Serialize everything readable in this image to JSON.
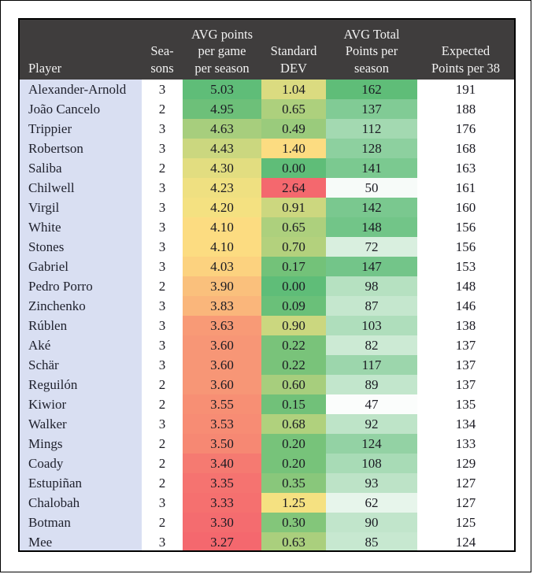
{
  "table": {
    "columns": [
      {
        "key": "player",
        "label": "Player",
        "align": "left"
      },
      {
        "key": "seasons",
        "label": "Sea-\nsons",
        "align": "center"
      },
      {
        "key": "avgpg",
        "label": "AVG points\nper game\nper season",
        "align": "center"
      },
      {
        "key": "sd",
        "label": "Standard\nDEV",
        "align": "center"
      },
      {
        "key": "avgtot",
        "label": "AVG Total\nPoints per\nseason",
        "align": "center"
      },
      {
        "key": "exp",
        "label": "Expected\nPoints per 38",
        "align": "center"
      }
    ],
    "header_lines": {
      "player": [
        "Player"
      ],
      "seasons": [
        "Sea-",
        "sons"
      ],
      "avgpg": [
        "AVG points",
        "per game",
        "per season"
      ],
      "sd": [
        "Standard",
        "DEV"
      ],
      "avgtot": [
        "AVG Total",
        "Points per",
        "season"
      ],
      "exp": [
        "Expected",
        "Points per 38"
      ]
    },
    "rows": [
      {
        "player": "Alexander-Arnold",
        "seasons": "3",
        "avgpg": "5.03",
        "sd": "1.04",
        "avgtot": "162",
        "exp": "191"
      },
      {
        "player": "João Cancelo",
        "seasons": "2",
        "avgpg": "4.95",
        "sd": "0.65",
        "avgtot": "137",
        "exp": "188"
      },
      {
        "player": "Trippier",
        "seasons": "3",
        "avgpg": "4.63",
        "sd": "0.49",
        "avgtot": "112",
        "exp": "176"
      },
      {
        "player": "Robertson",
        "seasons": "3",
        "avgpg": "4.43",
        "sd": "1.40",
        "avgtot": "128",
        "exp": "168"
      },
      {
        "player": "Saliba",
        "seasons": "2",
        "avgpg": "4.30",
        "sd": "0.00",
        "avgtot": "141",
        "exp": "163"
      },
      {
        "player": "Chilwell",
        "seasons": "3",
        "avgpg": "4.23",
        "sd": "2.64",
        "avgtot": "50",
        "exp": "161"
      },
      {
        "player": "Virgil",
        "seasons": "3",
        "avgpg": "4.20",
        "sd": "0.91",
        "avgtot": "142",
        "exp": "160"
      },
      {
        "player": "White",
        "seasons": "3",
        "avgpg": "4.10",
        "sd": "0.65",
        "avgtot": "148",
        "exp": "156"
      },
      {
        "player": "Stones",
        "seasons": "3",
        "avgpg": "4.10",
        "sd": "0.70",
        "avgtot": "72",
        "exp": "156"
      },
      {
        "player": "Gabriel",
        "seasons": "3",
        "avgpg": "4.03",
        "sd": "0.17",
        "avgtot": "147",
        "exp": "153"
      },
      {
        "player": "Pedro Porro",
        "seasons": "2",
        "avgpg": "3.90",
        "sd": "0.00",
        "avgtot": "98",
        "exp": "148"
      },
      {
        "player": "Zinchenko",
        "seasons": "3",
        "avgpg": "3.83",
        "sd": "0.09",
        "avgtot": "87",
        "exp": "146"
      },
      {
        "player": "Rúblen",
        "seasons": "3",
        "avgpg": "3.63",
        "sd": "0.90",
        "avgtot": "103",
        "exp": "138"
      },
      {
        "player": "Aké",
        "seasons": "3",
        "avgpg": "3.60",
        "sd": "0.22",
        "avgtot": "82",
        "exp": "137"
      },
      {
        "player": "Schär",
        "seasons": "3",
        "avgpg": "3.60",
        "sd": "0.22",
        "avgtot": "117",
        "exp": "137"
      },
      {
        "player": "Reguilón",
        "seasons": "2",
        "avgpg": "3.60",
        "sd": "0.60",
        "avgtot": "89",
        "exp": "137"
      },
      {
        "player": "Kiwior",
        "seasons": "2",
        "avgpg": "3.55",
        "sd": "0.15",
        "avgtot": "47",
        "exp": "135"
      },
      {
        "player": "Walker",
        "seasons": "3",
        "avgpg": "3.53",
        "sd": "0.68",
        "avgtot": "92",
        "exp": "134"
      },
      {
        "player": "Mings",
        "seasons": "2",
        "avgpg": "3.50",
        "sd": "0.20",
        "avgtot": "124",
        "exp": "133"
      },
      {
        "player": "Coady",
        "seasons": "2",
        "avgpg": "3.40",
        "sd": "0.20",
        "avgtot": "108",
        "exp": "129"
      },
      {
        "player": "Estupiñan",
        "seasons": "2",
        "avgpg": "3.35",
        "sd": "0.35",
        "avgtot": "93",
        "exp": "127"
      },
      {
        "player": "Chalobah",
        "seasons": "3",
        "avgpg": "3.33",
        "sd": "1.25",
        "avgtot": "62",
        "exp": "127"
      },
      {
        "player": "Botman",
        "seasons": "2",
        "avgpg": "3.30",
        "sd": "0.30",
        "avgtot": "90",
        "exp": "125"
      },
      {
        "player": "Mee",
        "seasons": "3",
        "avgpg": "3.27",
        "sd": "0.63",
        "avgtot": "85",
        "exp": "124"
      }
    ]
  },
  "style": {
    "header_bg": "#3f3d3d",
    "header_fg": "#f2f2f2",
    "player_col_bg": "#d9dff2",
    "plain_col_bg": "#ffffff",
    "border": "#000000",
    "scale_green": "#5fbd78",
    "scale_yellow": "#fde382",
    "scale_red": "#f4686e",
    "scale_white": "#fbfdfc"
  },
  "chart_data": {
    "type": "table",
    "title": "",
    "columns": [
      "Player",
      "Seasons",
      "AVG points per game per season",
      "Standard DEV",
      "AVG Total Points per season",
      "Expected Points per 38"
    ],
    "color_scales": {
      "avgpg": {
        "type": "3-color",
        "min": 3.27,
        "mid": 4.15,
        "max": 5.03,
        "colors": [
          "#f4686e",
          "#fde382",
          "#5fbd78"
        ]
      },
      "sd": {
        "type": "3-color",
        "min": 0.0,
        "mid": 1.32,
        "max": 2.64,
        "colors": [
          "#5fbd78",
          "#fde382",
          "#f4686e"
        ]
      },
      "avgtot": {
        "type": "2-color",
        "min": 47,
        "max": 162,
        "colors": [
          "#fbfdfc",
          "#5fbd78"
        ]
      }
    }
  }
}
